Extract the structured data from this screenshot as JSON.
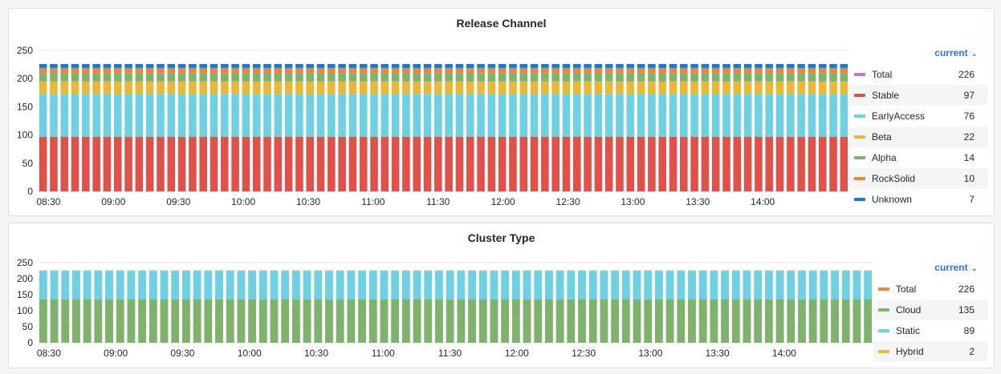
{
  "x_ticks": [
    "08:30",
    "09:00",
    "09:30",
    "10:00",
    "10:30",
    "11:00",
    "11:30",
    "12:00",
    "12:30",
    "13:00",
    "13:30",
    "14:00"
  ],
  "panels": [
    {
      "title": "Release Channel",
      "legend_label": "current",
      "legend": [
        {
          "name": "Total",
          "value": "226",
          "color": "#b877d9"
        },
        {
          "name": "Stable",
          "value": "97",
          "color": "#e0514b"
        },
        {
          "name": "EarlyAccess",
          "value": "76",
          "color": "#6ed0e0"
        },
        {
          "name": "Beta",
          "value": "22",
          "color": "#eab839"
        },
        {
          "name": "Alpha",
          "value": "14",
          "color": "#7eb26d"
        },
        {
          "name": "RockSolid",
          "value": "10",
          "color": "#ef843c"
        },
        {
          "name": "Unknown",
          "value": "7",
          "color": "#1f78c1"
        }
      ]
    },
    {
      "title": "Cluster Type",
      "legend_label": "current",
      "legend": [
        {
          "name": "Total",
          "value": "226",
          "color": "#ef843c"
        },
        {
          "name": "Cloud",
          "value": "135",
          "color": "#7eb26d"
        },
        {
          "name": "Static",
          "value": "89",
          "color": "#6ed0e0"
        },
        {
          "name": "Hybrid",
          "value": "2",
          "color": "#eab839"
        }
      ]
    }
  ],
  "chart_data": [
    {
      "type": "bar",
      "stacked": true,
      "title": "Release Channel",
      "xlabel": "",
      "ylabel": "",
      "ylim": [
        0,
        250
      ],
      "y_ticks": [
        0,
        50,
        100,
        150,
        200,
        250
      ],
      "x_range": [
        "08:25",
        "14:40"
      ],
      "bar_interval_minutes": 5,
      "bar_count": 76,
      "grid": true,
      "legend_position": "right",
      "series": [
        {
          "name": "Stable",
          "color": "#e0514b",
          "value": 97
        },
        {
          "name": "EarlyAccess",
          "color": "#6ed0e0",
          "value": 76
        },
        {
          "name": "Beta",
          "color": "#eab839",
          "value": 22
        },
        {
          "name": "Alpha",
          "color": "#7eb26d",
          "value": 14
        },
        {
          "name": "RockSolid",
          "color": "#ef843c",
          "value": 10
        },
        {
          "name": "Unknown",
          "color": "#1f78c1",
          "value": 7
        }
      ],
      "total": 226
    },
    {
      "type": "bar",
      "stacked": true,
      "title": "Cluster Type",
      "xlabel": "",
      "ylabel": "",
      "ylim": [
        0,
        250
      ],
      "y_ticks": [
        0,
        50,
        100,
        150,
        200,
        250
      ],
      "x_range": [
        "08:25",
        "14:40"
      ],
      "bar_interval_minutes": 5,
      "bar_count": 76,
      "grid": true,
      "legend_position": "right",
      "series": [
        {
          "name": "Cloud",
          "color": "#7eb26d",
          "value": 135
        },
        {
          "name": "Static",
          "color": "#6ed0e0",
          "value": 89
        },
        {
          "name": "Hybrid",
          "color": "#eab839",
          "value": 2
        }
      ],
      "total": 226
    }
  ]
}
